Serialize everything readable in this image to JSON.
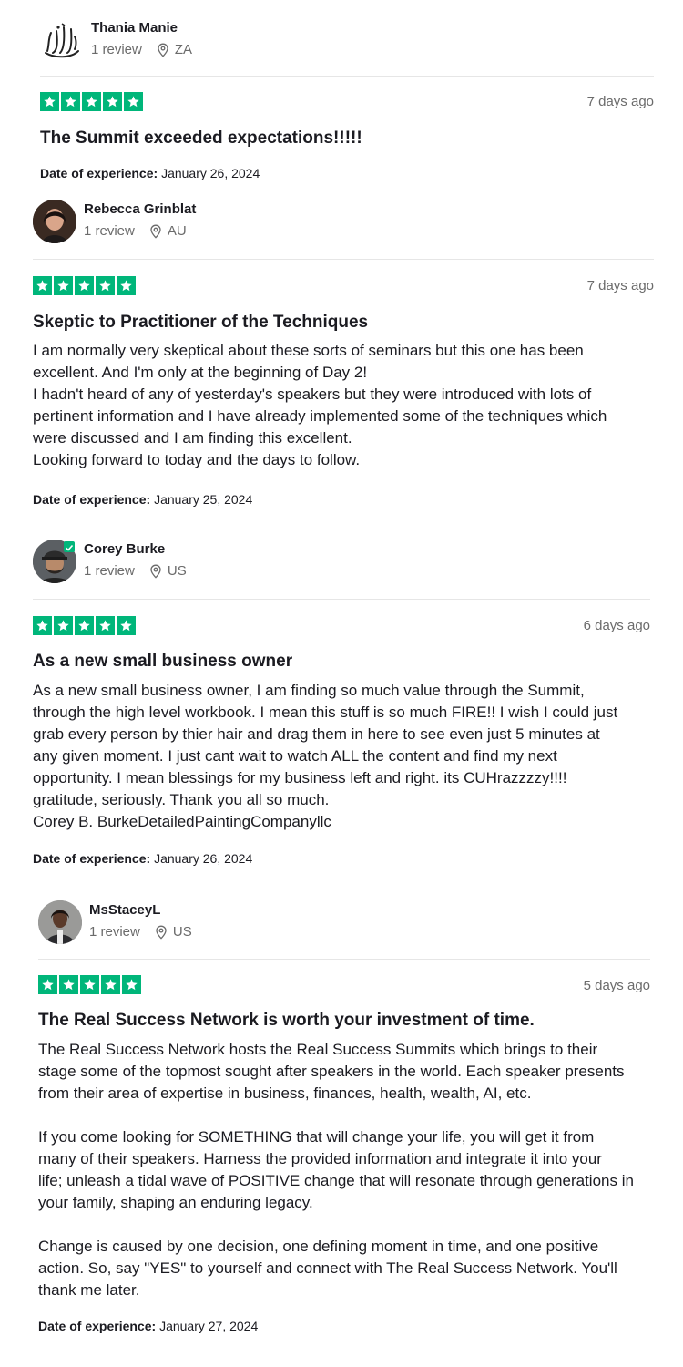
{
  "reviews": [
    {
      "user": {
        "name": "Thania Manie",
        "reviews": "1 review",
        "country": "ZA",
        "avatar_icon": "allah-calligraphy-icon"
      },
      "stars": 5,
      "date_ago": "7 days ago",
      "title": "The Summit exceeded expectations!!!!!",
      "body": [],
      "doe_label": "Date of experience:",
      "doe_value": "January 26, 2024"
    },
    {
      "user": {
        "name": "Rebecca Grinblat",
        "reviews": "1 review",
        "country": "AU",
        "avatar_icon": "profile-photo"
      },
      "stars": 5,
      "date_ago": "7 days ago",
      "title": "Skeptic to Practitioner of the Techniques",
      "body": [
        "I am normally very skeptical about these sorts of seminars but this one has been",
        "excellent. And I'm only at the beginning of Day 2!",
        "I hadn't heard of any of yesterday's speakers but they were introduced with lots of",
        "pertinent information and I have already implemented some of the techniques which",
        "were discussed and I am finding this excellent.",
        "Looking forward to today and the days to follow."
      ],
      "doe_label": "Date of experience:",
      "doe_value": "January 25, 2024"
    },
    {
      "user": {
        "name": "Corey Burke",
        "reviews": "1 review",
        "country": "US",
        "avatar_icon": "profile-photo-verified"
      },
      "stars": 5,
      "date_ago": "6 days ago",
      "title": "As a new small business owner",
      "body": [
        "As a new small business owner, I am finding so much value through the Summit,",
        "through the high level workbook. I mean this stuff is so much FIRE!! I wish I could just",
        "grab every person by thier hair and drag them in here to see even just 5 minutes at",
        "any given moment. I just cant wait to watch ALL the content and find my next",
        "opportunity. I mean blessings for my business left and right. its CUHrazzzzy!!!!",
        "gratitude, seriously. Thank you all so much.",
        "Corey B. BurkeDetailedPaintingCompanyllc"
      ],
      "doe_label": "Date of experience:",
      "doe_value": "January 26, 2024"
    },
    {
      "user": {
        "name": "MsStaceyL",
        "reviews": "1 review",
        "country": "US",
        "avatar_icon": "profile-photo"
      },
      "stars": 5,
      "date_ago": "5 days ago",
      "title": "The Real Success Network is worth your investment of time.",
      "body": [
        "The Real Success Network hosts the Real Success Summits which brings to their",
        "stage some of the topmost sought after speakers in the world. Each speaker presents",
        "from their area of expertise in business, finances, health, wealth, AI, etc.",
        "",
        "If you come looking for SOMETHING that will change your life, you will get it from",
        "many of their speakers. Harness the provided information and integrate it into your",
        "life; unleash a tidal wave of POSITIVE change that will resonate through generations in",
        "your family, shaping an enduring legacy.",
        "",
        "Change is caused by one decision, one defining moment in time, and one positive",
        "action. So, say \"YES\" to yourself and connect with The Real Success Network. You'll",
        "thank me later."
      ],
      "doe_label": "Date of experience:",
      "doe_value": "January 27, 2024"
    }
  ],
  "colors": {
    "star_green": "#00b67a",
    "text": "#1b1b21",
    "muted": "#6b6b6b",
    "divider": "#e6e6e6"
  }
}
